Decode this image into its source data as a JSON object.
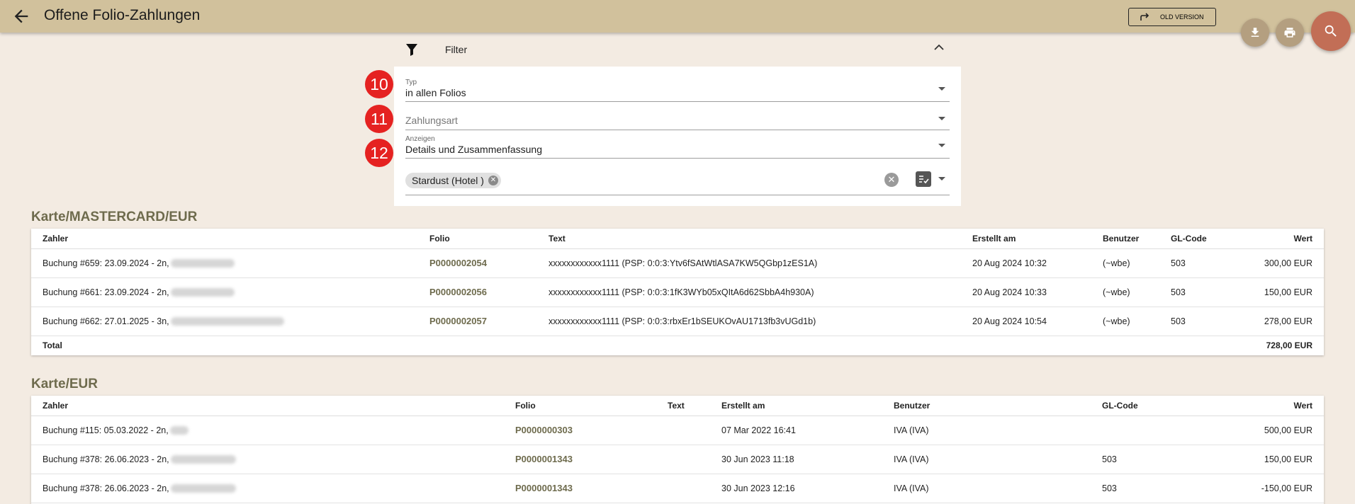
{
  "header": {
    "title": "Offene Folio-Zahlungen",
    "old_version_label": "OLD VERSION"
  },
  "filter": {
    "label": "Filter",
    "fields": [
      {
        "badge": "10",
        "label": "Typ",
        "value": "in allen Folios"
      },
      {
        "badge": "11",
        "placeholder": "Zahlungsart"
      },
      {
        "badge": "12",
        "label": "Anzeigen",
        "value": "Details und Zusammenfassung"
      }
    ],
    "chip": "Stardust (Hotel )"
  },
  "sections": [
    {
      "title": "Karte/MASTERCARD/EUR",
      "columns": [
        "Zahler",
        "Folio",
        "Text",
        "Erstellt am",
        "Benutzer",
        "GL-Code",
        "Wert"
      ],
      "rows": [
        {
          "zahler": "Buchung #659: 23.09.2024 - 2n,",
          "folio": "P0000002054",
          "text": "xxxxxxxxxxxx1111 (PSP: 0:0:3:Ytv6fSAtWtlASA7KW5QGbp1zES1A)",
          "erstellt": "20 Aug 2024 10:32",
          "benutzer": "(~wbe)",
          "gl": "503",
          "wert": "300,00 EUR"
        },
        {
          "zahler": "Buchung #661: 23.09.2024 - 2n,",
          "folio": "P0000002056",
          "text": "xxxxxxxxxxxx1111 (PSP: 0:0:3:1fK3WYb05xQItA6d62SbbA4h930A)",
          "erstellt": "20 Aug 2024 10:33",
          "benutzer": "(~wbe)",
          "gl": "503",
          "wert": "150,00 EUR"
        },
        {
          "zahler": "Buchung #662: 27.01.2025 - 3n,",
          "folio": "P0000002057",
          "text": "xxxxxxxxxxxx1111 (PSP: 0:0:3:rbxEr1bSEUKOvAU1713fb3vUGd1b)",
          "erstellt": "20 Aug 2024 10:54",
          "benutzer": "(~wbe)",
          "gl": "503",
          "wert": "278,00 EUR"
        }
      ],
      "total_label": "Total",
      "total_value": "728,00 EUR"
    },
    {
      "title": "Karte/EUR",
      "columns": [
        "Zahler",
        "Folio",
        "Text",
        "Erstellt am",
        "Benutzer",
        "GL-Code",
        "Wert"
      ],
      "rows": [
        {
          "zahler": "Buchung #115: 05.03.2022 - 2n,",
          "folio": "P0000000303",
          "text": "",
          "erstellt": "07 Mar 2022 16:41",
          "benutzer": "IVA (IVA)",
          "gl": "",
          "wert": "500,00 EUR"
        },
        {
          "zahler": "Buchung #378: 26.06.2023 - 2n,",
          "folio": "P0000001343",
          "text": "",
          "erstellt": "30 Jun 2023 11:18",
          "benutzer": "IVA (IVA)",
          "gl": "503",
          "wert": "150,00 EUR"
        },
        {
          "zahler": "Buchung #378: 26.06.2023 - 2n,",
          "folio": "P0000001343",
          "text": "",
          "erstellt": "30 Jun 2023 12:16",
          "benutzer": "IVA (IVA)",
          "gl": "503",
          "wert": "-150,00 EUR"
        }
      ]
    }
  ]
}
